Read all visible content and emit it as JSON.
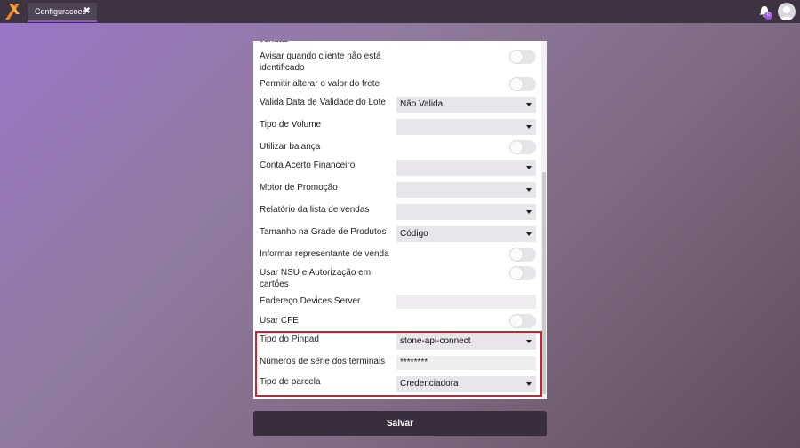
{
  "app": {
    "tab_label": "Configuracoes",
    "tab_close": "✖",
    "notification_count": "0",
    "icons": {
      "logo": "x-logo-icon",
      "bell": "bell-icon",
      "avatar": "user-avatar-icon",
      "close": "close-icon",
      "arrow": "chevron-down-icon"
    },
    "colors": {
      "topbar": "#3d3342",
      "accent": "#8b5cc4",
      "highlight": "#d21f2a",
      "button": "#3a2d3d"
    }
  },
  "form": {
    "rows": [
      {
        "label": "vendas"
      },
      {
        "label": "Avisar quando cliente não está identificado",
        "control": "toggle",
        "on": false
      },
      {
        "label": "Permitir alterar o valor do frete",
        "control": "toggle",
        "on": false
      },
      {
        "label": "Valida Data de Validade do Lote",
        "control": "select",
        "value": "Não Valida"
      },
      {
        "label": "Tipo de Volume",
        "control": "select",
        "value": ""
      },
      {
        "label": "Utilizar balança",
        "control": "toggle",
        "on": false
      },
      {
        "label": "Conta Acerto Financeiro",
        "control": "select",
        "value": ""
      },
      {
        "label": "Motor de Promoção",
        "control": "select",
        "value": ""
      },
      {
        "label": "Relatório da lista de vendas",
        "control": "select",
        "value": ""
      },
      {
        "label": "Tamanho na Grade de Produtos",
        "control": "select",
        "value": "Código"
      },
      {
        "label": "Informar representante de venda",
        "control": "toggle",
        "on": false
      },
      {
        "label": "Usar NSU e Autorização em cartões",
        "control": "toggle",
        "on": false
      },
      {
        "label": "Endereço Devices Server",
        "control": "input",
        "value": ""
      },
      {
        "label": "Usar CFE",
        "control": "toggle",
        "on": false
      },
      {
        "label": "Tipo do Pinpad",
        "control": "select",
        "value": "stone-api-connect"
      },
      {
        "label": "Números de série dos terminais",
        "control": "input",
        "value": "********"
      },
      {
        "label": "Tipo de parcela",
        "control": "select",
        "value": "Credenciadora"
      }
    ],
    "save_label": "Salvar"
  }
}
